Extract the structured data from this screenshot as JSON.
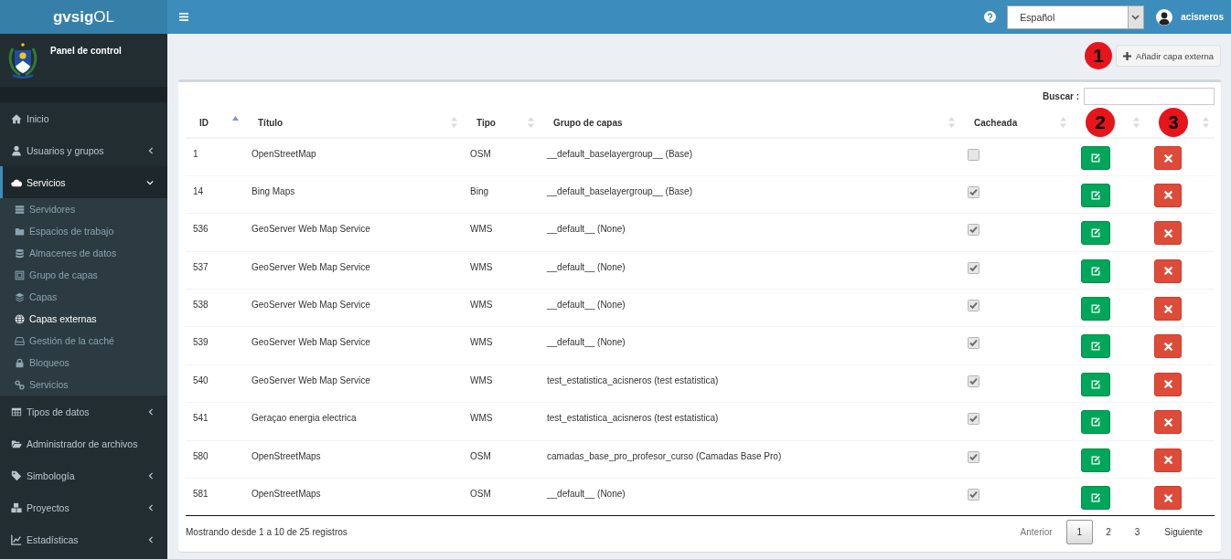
{
  "header": {
    "logo": "**gvsig**OL",
    "language_select": {
      "value": "Español"
    },
    "user": {
      "name": "acisneros"
    }
  },
  "sidebar": {
    "panel_title": "Panel de control",
    "menu": [
      {
        "label": "Inicio",
        "kind": "link",
        "selected": false
      },
      {
        "label": "Usuarios y grupos",
        "kind": "group",
        "expanded": false,
        "selected": false
      },
      {
        "label": "Servicios",
        "kind": "group",
        "expanded": true,
        "selected": true,
        "children": [
          {
            "label": "Servidores",
            "selected": false
          },
          {
            "label": "Espacios de trabajo",
            "selected": false
          },
          {
            "label": "Almacenes de datos",
            "selected": false
          },
          {
            "label": "Grupo de capas",
            "selected": false
          },
          {
            "label": "Capas",
            "selected": false
          },
          {
            "label": "Capas externas",
            "selected": true
          },
          {
            "label": "Gestión de la caché",
            "selected": false
          },
          {
            "label": "Bloqueos",
            "selected": false
          },
          {
            "label": "Servicios",
            "selected": false
          }
        ]
      },
      {
        "label": "Tipos de datos",
        "kind": "group",
        "expanded": false,
        "selected": false
      },
      {
        "label": "Administrador de archivos",
        "kind": "link",
        "selected": false
      },
      {
        "label": "Simbología",
        "kind": "group",
        "expanded": false,
        "selected": false
      },
      {
        "label": "Proyectos",
        "kind": "group",
        "expanded": false,
        "selected": false
      },
      {
        "label": "Estadísticas",
        "kind": "group",
        "expanded": false,
        "selected": false
      }
    ]
  },
  "toolbar": {
    "marker": "1",
    "add_button": "Añadir capa externa"
  },
  "table": {
    "search": {
      "label": "Buscar :"
    },
    "columns": [
      {
        "label": "ID",
        "sorted": true
      },
      {
        "label": "Título",
        "sorted": false
      },
      {
        "label": "Tipo",
        "sorted": false
      },
      {
        "label": "Grupo de capas",
        "sorted": false
      },
      {
        "label": "Cacheada",
        "sorted": false
      },
      {
        "marker": "2",
        "sorted": false
      },
      {
        "marker": "3",
        "sorted": false
      }
    ],
    "rows": [
      {
        "id": "1",
        "title": "OpenStreetMap",
        "type": "OSM",
        "group": "__default_baselayergroup__ (Base)",
        "cached": false
      },
      {
        "id": "14",
        "title": "Bing Maps",
        "type": "Bing",
        "group": "__default_baselayergroup__ (Base)",
        "cached": true
      },
      {
        "id": "536",
        "title": "GeoServer Web Map Service",
        "type": "WMS",
        "group": "__default__ (None)",
        "cached": true
      },
      {
        "id": "537",
        "title": "GeoServer Web Map Service",
        "type": "WMS",
        "group": "__default__ (None)",
        "cached": true
      },
      {
        "id": "538",
        "title": "GeoServer Web Map Service",
        "type": "WMS",
        "group": "__default__ (None)",
        "cached": true
      },
      {
        "id": "539",
        "title": "GeoServer Web Map Service",
        "type": "WMS",
        "group": "__default__ (None)",
        "cached": true
      },
      {
        "id": "540",
        "title": "GeoServer Web Map Service",
        "type": "WMS",
        "group": "test_estatistica_acisneros (test estatistica)",
        "cached": true
      },
      {
        "id": "541",
        "title": "Geraçao energia electrica",
        "type": "WMS",
        "group": "test_estatistica_acisneros (test estatistica)",
        "cached": true
      },
      {
        "id": "580",
        "title": "OpenStreetMaps",
        "type": "OSM",
        "group": "camadas_base_pro_profesor_curso (Camadas Base Pro)",
        "cached": true
      },
      {
        "id": "581",
        "title": "OpenStreetMaps",
        "type": "OSM",
        "group": "__default__ (None)",
        "cached": true
      }
    ],
    "info": "Mostrando desde 1 a 10 de 25 registros",
    "pagination": {
      "previous": {
        "label": "Anterior",
        "disabled": true
      },
      "pages": [
        {
          "label": "1",
          "selected": true
        },
        {
          "label": "2",
          "selected": false
        },
        {
          "label": "3",
          "selected": false
        }
      ],
      "next": {
        "label": "Siguiente",
        "disabled": false
      }
    }
  }
}
